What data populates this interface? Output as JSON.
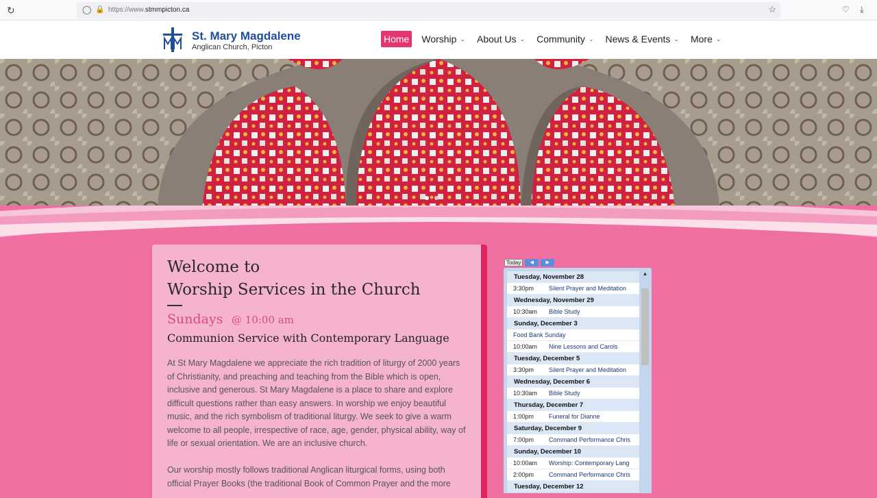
{
  "browser": {
    "url_prefix": "https://www.",
    "url_domain": "stmmpicton.ca"
  },
  "site": {
    "name": "St. Mary Magdalene",
    "subtitle": "Anglican Church, Picton"
  },
  "nav": {
    "items": [
      {
        "label": "Home"
      },
      {
        "label": "Worship"
      },
      {
        "label": "About Us"
      },
      {
        "label": "Community"
      },
      {
        "label": "News & Events"
      },
      {
        "label": "More"
      }
    ]
  },
  "welcome": {
    "title_line1": "Welcome to",
    "title_line2": "Worship Services in the Church",
    "day": "Sundays",
    "time": "@ 10:00 am",
    "service": "Communion Service with Contemporary Language",
    "para1": "At St Mary Magdalene we appreciate the rich tradition of liturgy of 2000 years of Christianity, and preaching and teaching from the Bible which is open, inclusive and generous. St Mary Magdalene is a place to share and explore difficult questions rather than easy answers. In worship we enjoy beautiful music, and the rich symbolism of traditional liturgy. We seek to give a warm welcome to all people, irrespective of race, age, gender, physical ability, way of life or sexual orientation. We are an inclusive church.",
    "para2": "Our worship mostly follows traditional Anglican liturgical forms, using both official Prayer Books (the traditional Book of Common Prayer and the more"
  },
  "calendar": {
    "today_label": "Today",
    "prev_icon": "◀",
    "next_icon": "▶",
    "days": [
      {
        "date": "Tuesday, November 28",
        "events": [
          {
            "time": "3:30pm",
            "title": "Silent Prayer and Meditation"
          }
        ]
      },
      {
        "date": "Wednesday, November 29",
        "events": [
          {
            "time": "10:30am",
            "title": "Bible Study"
          }
        ]
      },
      {
        "date": "Sunday, December 3",
        "events": [
          {
            "time": "",
            "title": "Food Bank Sunday"
          },
          {
            "time": "10:00am",
            "title": "Nine Lessons and Carols"
          }
        ]
      },
      {
        "date": "Tuesday, December 5",
        "events": [
          {
            "time": "3:30pm",
            "title": "Silent Prayer and Meditation"
          }
        ]
      },
      {
        "date": "Wednesday, December 6",
        "events": [
          {
            "time": "10:30am",
            "title": "Bible Study"
          }
        ]
      },
      {
        "date": "Thursday, December 7",
        "events": [
          {
            "time": "1:00pm",
            "title": "Funeral for Dianne"
          }
        ]
      },
      {
        "date": "Saturday, December 9",
        "events": [
          {
            "time": "7:00pm",
            "title": "Command Performance Chris"
          }
        ]
      },
      {
        "date": "Sunday, December 10",
        "events": [
          {
            "time": "10:00am",
            "title": "Worship: Contemporary Lang"
          },
          {
            "time": "2:00pm",
            "title": "Command Performance Chris"
          }
        ]
      },
      {
        "date": "Tuesday, December 12",
        "events": []
      }
    ]
  }
}
